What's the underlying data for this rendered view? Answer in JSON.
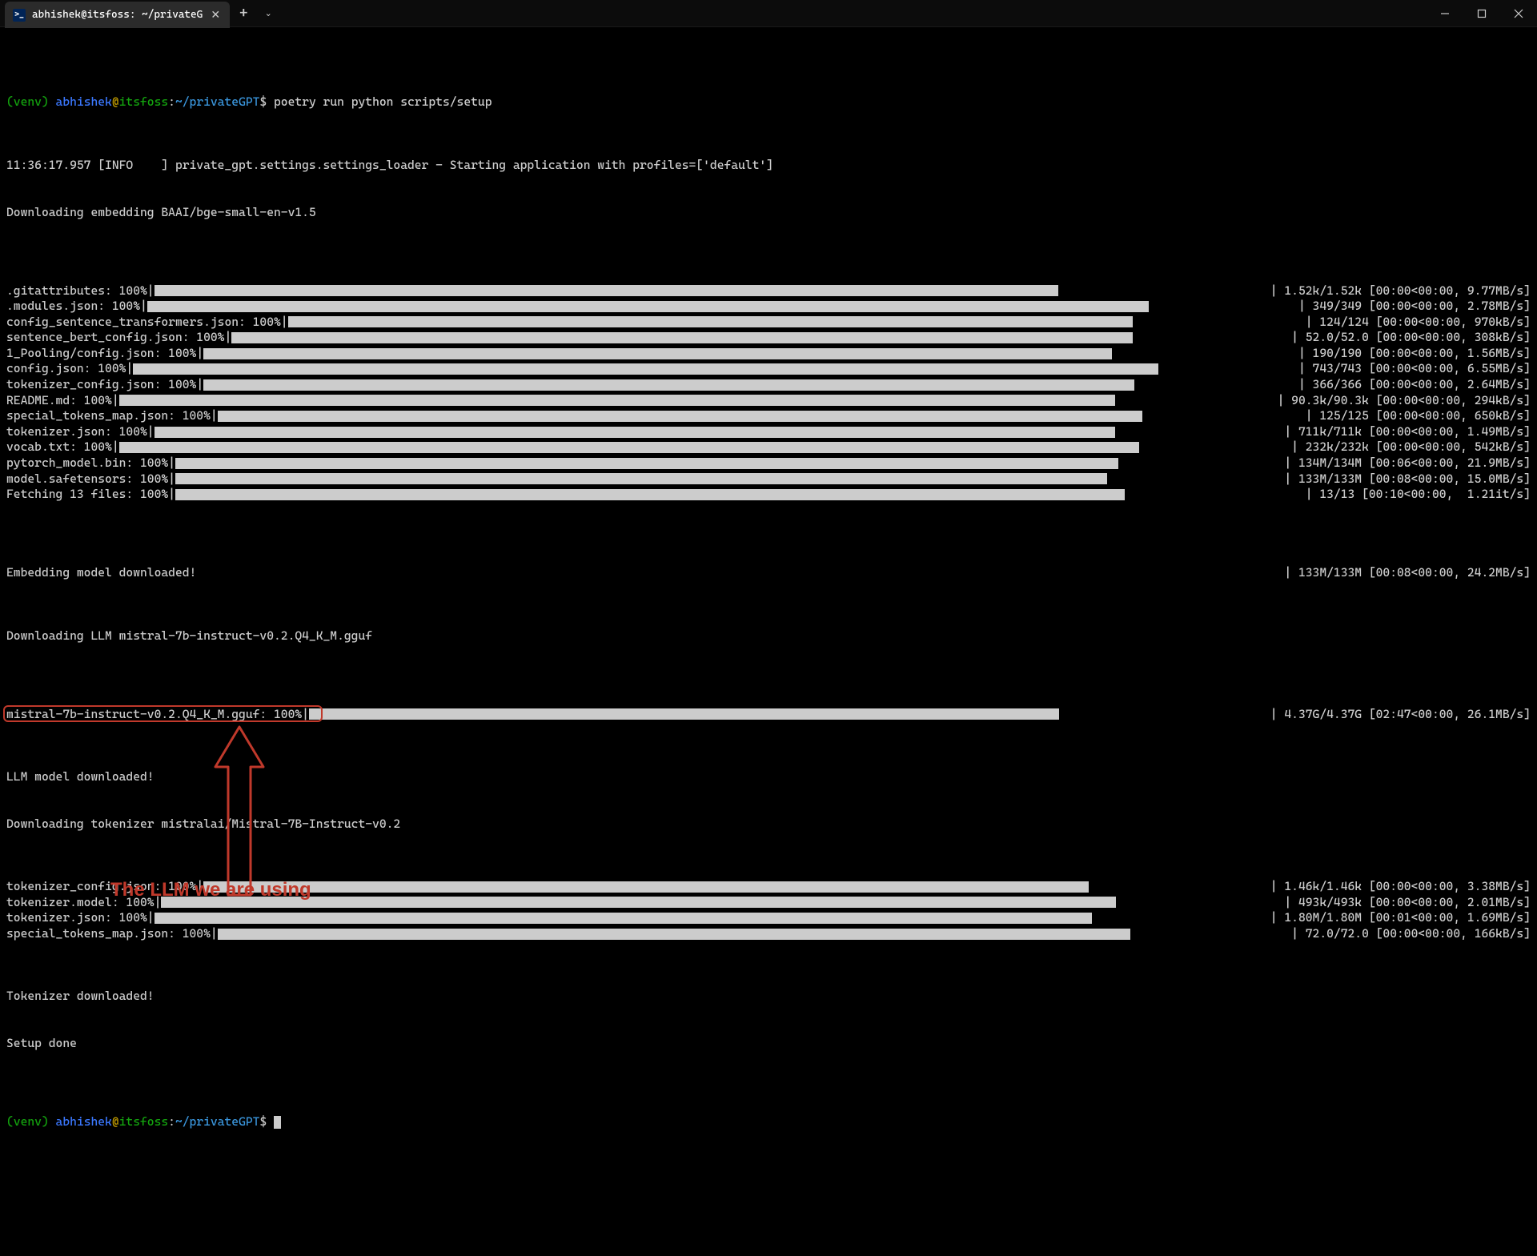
{
  "window": {
    "tab_title": "abhishek@itsfoss: ~/privateG",
    "ps_icon_label": ">_"
  },
  "prompt1": {
    "venv": "(venv) ",
    "user": "abhishek",
    "at": "@",
    "host": "itsfoss",
    "colon": ":",
    "path": "~/privateGPT",
    "dollar": "$ ",
    "cmd": "poetry run python scripts/setup"
  },
  "lines": {
    "l1": "11:36:17.957 [INFO    ] private_gpt.settings.settings_loader - Starting application with profiles=['default']",
    "l2": "Downloading embedding BAAI/bge-small-en-v1.5",
    "l_embed_done": "Embedding model downloaded!",
    "l_dl_llm": "Downloading LLM mistral-7b-instruct-v0.2.Q4_K_M.gguf",
    "l_llm_done": "LLM model downloaded!",
    "l_dl_tok": "Downloading tokenizer mistralai/Mistral-7B-Instruct-v0.2",
    "l_tok_done": "Tokenizer downloaded!",
    "l_setup_done": "Setup done"
  },
  "progress": [
    {
      "label": ".gitattributes: 100%",
      "bar": 0.81,
      "stats": "| 1.52k/1.52k [00:00<00:00, 9.77MB/s]"
    },
    {
      "label": ".modules.json: 100%",
      "bar": 0.87,
      "stats": "| 349/349 [00:00<00:00, 2.78MB/s]"
    },
    {
      "label": "config_sentence_transformers.json: 100%",
      "bar": 0.83,
      "stats": "| 124/124 [00:00<00:00, 970kB/s]"
    },
    {
      "label": "sentence_bert_config.json: 100%",
      "bar": 0.85,
      "stats": "| 52.0/52.0 [00:00<00:00, 308kB/s]"
    },
    {
      "label": "1_Pooling/config.json: 100%",
      "bar": 0.83,
      "stats": "| 190/190 [00:00<00:00, 1.56MB/s]"
    },
    {
      "label": "config.json: 100%",
      "bar": 0.88,
      "stats": "| 743/743 [00:00<00:00, 6.55MB/s]"
    },
    {
      "label": "tokenizer_config.json: 100%",
      "bar": 0.85,
      "stats": "| 366/366 [00:00<00:00, 2.64MB/s]"
    },
    {
      "label": "README.md: 100%",
      "bar": 0.86,
      "stats": "| 90.3k/90.3k [00:00<00:00, 294kB/s]"
    },
    {
      "label": "special_tokens_map.json: 100%",
      "bar": 0.85,
      "stats": "| 125/125 [00:00<00:00, 650kB/s]"
    },
    {
      "label": "tokenizer.json: 100%",
      "bar": 0.85,
      "stats": "| 711k/711k [00:00<00:00, 1.49MB/s]"
    },
    {
      "label": "vocab.txt: 100%",
      "bar": 0.87,
      "stats": "| 232k/232k [00:00<00:00, 542kB/s]"
    },
    {
      "label": "pytorch_model.bin: 100%",
      "bar": 0.85,
      "stats": "| 134M/134M [00:06<00:00, 21.9MB/s]"
    },
    {
      "label": "model.safetensors: 100%",
      "bar": 0.84,
      "stats": "| 133M/133M [00:08<00:00, 15.0MB/s]"
    },
    {
      "label": "Fetching 13 files: 100%",
      "bar": 0.84,
      "stats": "| 13/13 [00:10<00:00,  1.21it/s]"
    }
  ],
  "progress_embed_tail": {
    "stats": "| 133M/133M [00:08<00:00, 24.2MB/s]"
  },
  "progress_llm": {
    "label": "mistral-7b-instruct-v0.2.Q4_K_M.gguf: 100%",
    "bar": 0.78,
    "stats": "| 4.37G/4.37G [02:47<00:00, 26.1MB/s]"
  },
  "progress_tok": [
    {
      "label": "tokenizer_config.json: 100%",
      "bar": 0.83,
      "stats": "| 1.46k/1.46k [00:00<00:00, 3.38MB/s]"
    },
    {
      "label": "tokenizer.model: 100%",
      "bar": 0.85,
      "stats": "| 493k/493k [00:00<00:00, 2.01MB/s]"
    },
    {
      "label": "tokenizer.json: 100%",
      "bar": 0.84,
      "stats": "| 1.80M/1.80M [00:01<00:00, 1.69MB/s]"
    },
    {
      "label": "special_tokens_map.json: 100%",
      "bar": 0.85,
      "stats": "| 72.0/72.0 [00:00<00:00, 166kB/s]"
    }
  ],
  "prompt2": {
    "venv": "(venv) ",
    "user": "abhishek",
    "at": "@",
    "host": "itsfoss",
    "colon": ":",
    "path": "~/privateGPT",
    "dollar": "$ "
  },
  "annotation": {
    "text": "The LLM we are using"
  }
}
